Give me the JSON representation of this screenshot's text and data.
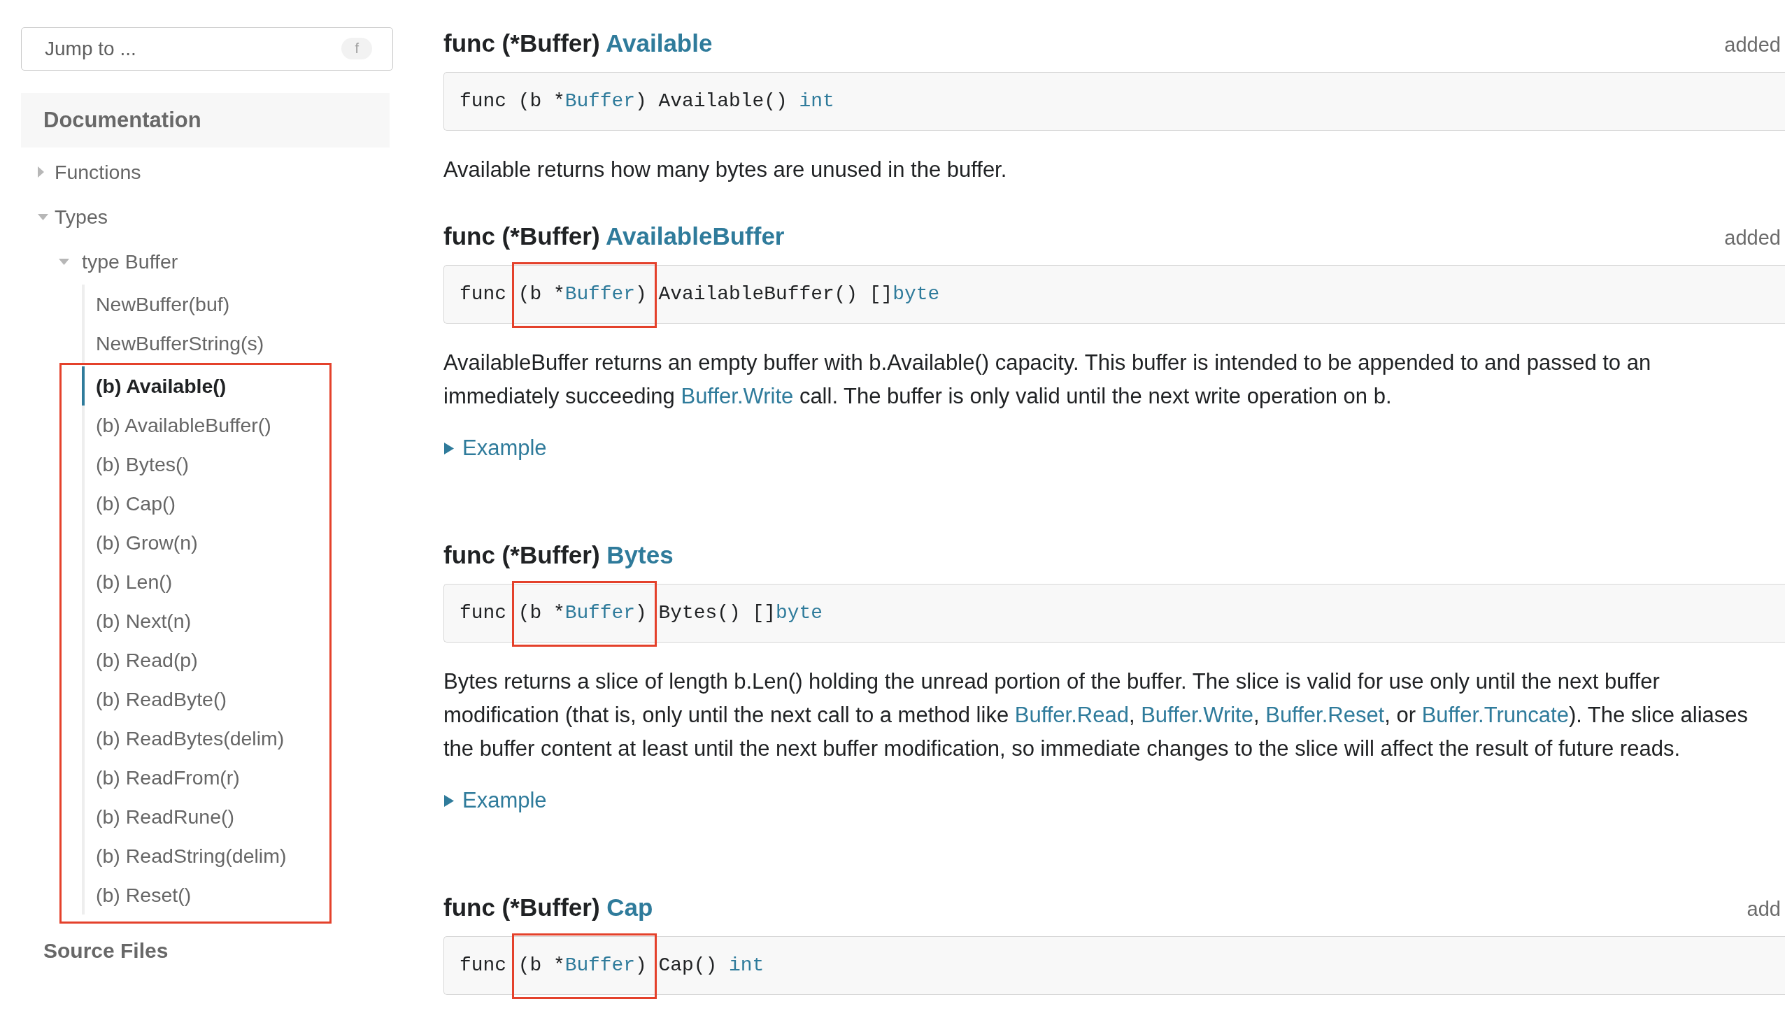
{
  "sidebar": {
    "jump_field": {
      "placeholder": "Jump to ...",
      "shortcut": "f"
    },
    "section_title": "Documentation",
    "tree": [
      {
        "label": "Functions",
        "kind": "group",
        "expanded": false,
        "selected": false
      },
      {
        "label": "Types",
        "kind": "group",
        "expanded": true,
        "selected": false,
        "children": [
          {
            "label": "type Buffer",
            "kind": "group",
            "expanded": true,
            "selected": false,
            "children": [
              {
                "label": "NewBuffer(buf)",
                "kind": "link",
                "selected": false
              },
              {
                "label": "NewBufferString(s)",
                "kind": "link",
                "selected": false
              },
              {
                "label": "(b) Available()",
                "kind": "highlighted_link",
                "selected": true
              },
              {
                "label": "(b) AvailableBuffer()",
                "kind": "highlighted_link",
                "selected": false
              },
              {
                "label": "(b) Bytes()",
                "kind": "highlighted_link",
                "selected": false
              },
              {
                "label": "(b) Cap()",
                "kind": "highlighted_link",
                "selected": false
              },
              {
                "label": "(b) Grow(n)",
                "kind": "highlighted_link",
                "selected": false
              },
              {
                "label": "(b) Len()",
                "kind": "highlighted_link",
                "selected": false
              },
              {
                "label": "(b) Next(n)",
                "kind": "highlighted_link",
                "selected": false
              },
              {
                "label": "(b) Read(p)",
                "kind": "highlighted_link",
                "selected": false
              },
              {
                "label": "(b) ReadByte()",
                "kind": "highlighted_link",
                "selected": false
              },
              {
                "label": "(b) ReadBytes(delim)",
                "kind": "highlighted_link",
                "selected": false
              },
              {
                "label": "(b) ReadFrom(r)",
                "kind": "highlighted_link",
                "selected": false
              },
              {
                "label": "(b) ReadRune()",
                "kind": "highlighted_link",
                "selected": false
              },
              {
                "label": "(b) ReadString(delim)",
                "kind": "highlighted_link",
                "selected": false
              },
              {
                "label": "(b) Reset()",
                "kind": "highlighted_link",
                "selected": false
              }
            ]
          }
        ]
      }
    ],
    "footer_title": "Source Files"
  },
  "methods": [
    {
      "heading": {
        "prefix": "func (*Buffer)",
        "name": "Available"
      },
      "version": "added",
      "signature": [
        {
          "kind": "text",
          "text": "func "
        },
        {
          "kind": "receiver",
          "parts": [
            {
              "kind": "text",
              "text": "(b *"
            },
            {
              "kind": "link",
              "text": "Buffer"
            },
            {
              "kind": "text",
              "text": ")"
            }
          ]
        },
        {
          "kind": "text",
          "text": " Available() "
        },
        {
          "kind": "link",
          "text": "int"
        }
      ],
      "description": [
        {
          "kind": "text",
          "text": "Available returns how many bytes are unused in the buffer."
        }
      ]
    },
    {
      "heading": {
        "prefix": "func (*Buffer)",
        "name": "AvailableBuffer"
      },
      "version": "added",
      "signature": [
        {
          "kind": "text",
          "text": "func "
        },
        {
          "kind": "highlighted_receiver",
          "parts": [
            {
              "kind": "text",
              "text": "(b *"
            },
            {
              "kind": "link",
              "text": "Buffer"
            },
            {
              "kind": "text",
              "text": ")"
            }
          ]
        },
        {
          "kind": "text",
          "text": " AvailableBuffer() []"
        },
        {
          "kind": "link",
          "text": "byte"
        }
      ],
      "description": [
        {
          "kind": "text",
          "text": "AvailableBuffer returns an empty buffer with b.Available() capacity. This buffer is intended to be appended to and passed to an immediately succeeding "
        },
        {
          "kind": "link",
          "text": "Buffer.Write"
        },
        {
          "kind": "text",
          "text": " call. The buffer is only valid until the next write operation on b."
        }
      ],
      "example": {
        "label": "Example",
        "expanded": false
      }
    },
    {
      "heading": {
        "prefix": "func (*Buffer)",
        "name": "Bytes"
      },
      "signature": [
        {
          "kind": "text",
          "text": "func "
        },
        {
          "kind": "highlighted_receiver",
          "parts": [
            {
              "kind": "text",
              "text": "(b *"
            },
            {
              "kind": "link",
              "text": "Buffer"
            },
            {
              "kind": "text",
              "text": ")"
            }
          ]
        },
        {
          "kind": "text",
          "text": " Bytes() []"
        },
        {
          "kind": "link",
          "text": "byte"
        }
      ],
      "description": [
        {
          "kind": "text",
          "text": "Bytes returns a slice of length b.Len() holding the unread portion of the buffer. The slice is valid for use only until the next buffer modification (that is, only until the next call to a method like "
        },
        {
          "kind": "link",
          "text": "Buffer.Read"
        },
        {
          "kind": "text",
          "text": ", "
        },
        {
          "kind": "link",
          "text": "Buffer.Write"
        },
        {
          "kind": "text",
          "text": ", "
        },
        {
          "kind": "link",
          "text": "Buffer.Reset"
        },
        {
          "kind": "text",
          "text": ", or "
        },
        {
          "kind": "link",
          "text": "Buffer.Truncate"
        },
        {
          "kind": "text",
          "text": "). The slice aliases the buffer content at least until the next buffer modification, so immediate changes to the slice will affect the result of future reads."
        }
      ],
      "example": {
        "label": "Example",
        "expanded": false
      }
    },
    {
      "heading": {
        "prefix": "func (*Buffer)",
        "name": "Cap"
      },
      "version": "add",
      "signature": [
        {
          "kind": "text",
          "text": "func "
        },
        {
          "kind": "highlighted_receiver",
          "parts": [
            {
              "kind": "text",
              "text": "(b *"
            },
            {
              "kind": "link",
              "text": "Buffer"
            },
            {
              "kind": "text",
              "text": ")"
            }
          ]
        },
        {
          "kind": "text",
          "text": " Cap() "
        },
        {
          "kind": "link",
          "text": "int"
        }
      ]
    }
  ]
}
